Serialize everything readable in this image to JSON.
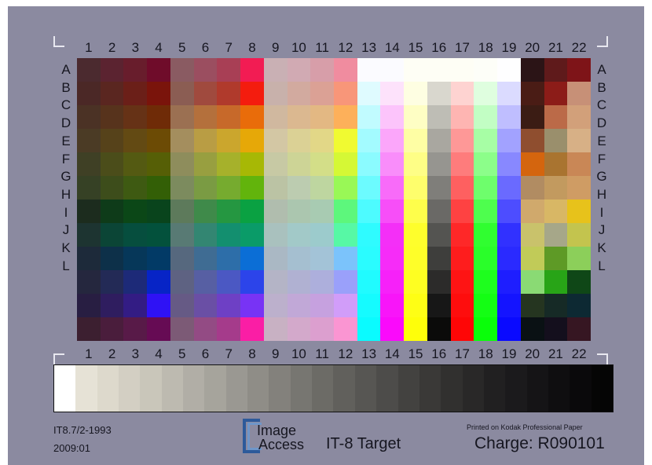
{
  "columns": [
    "1",
    "2",
    "3",
    "4",
    "5",
    "6",
    "7",
    "8",
    "9",
    "10",
    "11",
    "12",
    "13",
    "14",
    "15",
    "16",
    "17",
    "18",
    "19",
    "20",
    "21",
    "22"
  ],
  "rows": [
    "A",
    "B",
    "C",
    "D",
    "E",
    "F",
    "G",
    "H",
    "I",
    "J",
    "K",
    "L"
  ],
  "footer": {
    "standard": "IT8.7/2-1993",
    "date": "2009:01",
    "logo_line1": "Image",
    "logo_line2": "Access",
    "title": "IT-8 Target",
    "paper_note": "Printed on Kodak Professional Paper",
    "charge": "Charge: R090101"
  },
  "patch_colors": [
    [
      "#4b2a2f",
      "#5b2330",
      "#681d2c",
      "#6f0c2a",
      "#8a5b62",
      "#9b4e60",
      "#a83f55",
      "#f21c53",
      "#c9b0b4",
      "#d1aab3",
      "#d79ea9",
      "#f08c9f",
      "#fbfbff",
      "#fbfbff",
      "#fefef5",
      "#fefef5",
      "#fefef5",
      "#fdfef8",
      "#fefeff",
      "#2b1416",
      "#5f1a1b",
      "#7e1418"
    ],
    [
      "#4b2826",
      "#5a2620",
      "#6b1f18",
      "#7a140b",
      "#8b5d53",
      "#a04a3e",
      "#b03a2c",
      "#f41c0e",
      "#c8b1ab",
      "#d2aa9f",
      "#dba195",
      "#f89679",
      "#dffbff",
      "#fde2fb",
      "#fefee2",
      "#d9d7ce",
      "#fed3d1",
      "#dffedf",
      "#dbdbff",
      "#4a1c15",
      "#8c1c18",
      "#c79077"
    ],
    [
      "#4b3225",
      "#57331c",
      "#663216",
      "#6f2b07",
      "#9b7052",
      "#b4703c",
      "#c7692a",
      "#e96c0a",
      "#d0b89f",
      "#dbb890",
      "#e3b883",
      "#fdb05a",
      "#c1fbff",
      "#fcc4fb",
      "#fefec4",
      "#bebdb5",
      "#feb5b2",
      "#c2fec4",
      "#bfbeff",
      "#3b1c14",
      "#bb6a48",
      "#d2a07a"
    ],
    [
      "#4b3b25",
      "#56421a",
      "#634a13",
      "#6c4b05",
      "#a48e5e",
      "#b99d44",
      "#cba62d",
      "#e6a808",
      "#d3c7a4",
      "#dbd195",
      "#e2d787",
      "#f0fa31",
      "#a3fbff",
      "#fba6fa",
      "#fefea4",
      "#a9a7a0",
      "#fe9897",
      "#a7fea5",
      "#a2a2ff",
      "#8f4e2f",
      "#9a8f6c",
      "#d7b086"
    ],
    [
      "#3f4025",
      "#4b4d1a",
      "#545a12",
      "#565f06",
      "#8e8d5c",
      "#989f40",
      "#a6b12b",
      "#a7b805",
      "#c7c9a4",
      "#cdd496",
      "#d3de88",
      "#d5f835",
      "#8bfbff",
      "#f98dfa",
      "#fefe86",
      "#969590",
      "#fe7c7c",
      "#8cfe8a",
      "#8888ff",
      "#d4650e",
      "#a97430",
      "#c98756"
    ],
    [
      "#364125",
      "#3d4d1b",
      "#3e5a12",
      "#335f06",
      "#7c8b5e",
      "#7a9b43",
      "#76ab2f",
      "#62b40c",
      "#bbc3a4",
      "#bcccb0",
      "#bed6a0",
      "#99f856",
      "#6cfbff",
      "#f86bf9",
      "#fefe6c",
      "#7f7e7a",
      "#fe6060",
      "#6efe6c",
      "#6a6aff",
      "#b18c62",
      "#c29a5f",
      "#cf9c64"
    ],
    [
      "#1c2c1e",
      "#0e3b19",
      "#0b4717",
      "#09441c",
      "#5d7a5b",
      "#3f8a4a",
      "#259741",
      "#0aa142",
      "#b0bdae",
      "#abc6af",
      "#a8cbb2",
      "#5df77c",
      "#4dfbff",
      "#f74ef8",
      "#fefe4b",
      "#6a6966",
      "#fe4242",
      "#4efe4e",
      "#4d4dff",
      "#d0a96c",
      "#d8b765",
      "#e7c21b"
    ],
    [
      "#1d3431",
      "#0b4536",
      "#064e3e",
      "#03513c",
      "#587a74",
      "#338672",
      "#138f6f",
      "#0a9b68",
      "#a9c1be",
      "#a2c9c8",
      "#9ccbcc",
      "#57f8a5",
      "#2ffbff",
      "#f42ff7",
      "#fefe2c",
      "#545451",
      "#fe2828",
      "#30fe30",
      "#3131ff",
      "#c9c26b",
      "#a6a789",
      "#c3c44e"
    ],
    [
      "#1d2a3a",
      "#0d3049",
      "#063759",
      "#023a66",
      "#56687e",
      "#3f6c93",
      "#2d6ea9",
      "#0b6ed6",
      "#aab8c4",
      "#a5bfd0",
      "#a3c3d7",
      "#7bc3fb",
      "#2afcff",
      "#f62cf8",
      "#fefe29",
      "#3e3e3c",
      "#fe1d1d",
      "#2afe2a",
      "#2a2aff",
      "#c1cb58",
      "#5e9a26",
      "#8ccf5a"
    ],
    [
      "#25273e",
      "#232a56",
      "#1d2a78",
      "#0724c6",
      "#5e6282",
      "#575fa3",
      "#4b58c3",
      "#2c44ea",
      "#b4b4c6",
      "#b0b1d2",
      "#adafdc",
      "#9aa0fa",
      "#20fbff",
      "#f621f9",
      "#fefe22",
      "#2c2b2a",
      "#fe1414",
      "#1efe1e",
      "#1e1eff",
      "#8ada74",
      "#28a417",
      "#0f4717"
    ],
    [
      "#281e42",
      "#2f1d5f",
      "#331c84",
      "#2f12f5",
      "#665a85",
      "#6a4fa5",
      "#6e40c5",
      "#7833f5",
      "#bcb0cc",
      "#c1a8d7",
      "#c6a1df",
      "#d19df9",
      "#15fbff",
      "#f815f9",
      "#fefe15",
      "#171717",
      "#fe0d0d",
      "#14fe14",
      "#1414ff",
      "#253520",
      "#162a26",
      "#0d2933"
    ],
    [
      "#3c1f30",
      "#4a1d3c",
      "#581a48",
      "#660b54",
      "#7c5a76",
      "#934b84",
      "#a53b8b",
      "#fa1ea5",
      "#c8b1c3",
      "#d3a9cb",
      "#dc9fcf",
      "#fa95d2",
      "#0afbff",
      "#fa0afb",
      "#fefe0a",
      "#0b0b0a",
      "#fe0606",
      "#0afe0a",
      "#0a0aff",
      "#0a1114",
      "#140f1d",
      "#361622"
    ]
  ],
  "gray_steps": [
    "#ffffff",
    "#e6e2d6",
    "#ddd9cc",
    "#d3cfc3",
    "#c9c6ba",
    "#bdbab0",
    "#b1aea6",
    "#a6a49c",
    "#9a9892",
    "#8f8d87",
    "#83817c",
    "#777671",
    "#6c6b66",
    "#61605c",
    "#575653",
    "#4d4c4a",
    "#434240",
    "#3a3937",
    "#31302f",
    "#292828",
    "#212021",
    "#1b1a1c",
    "#151416",
    "#0f0e10",
    "#0a090b",
    "#050505"
  ]
}
